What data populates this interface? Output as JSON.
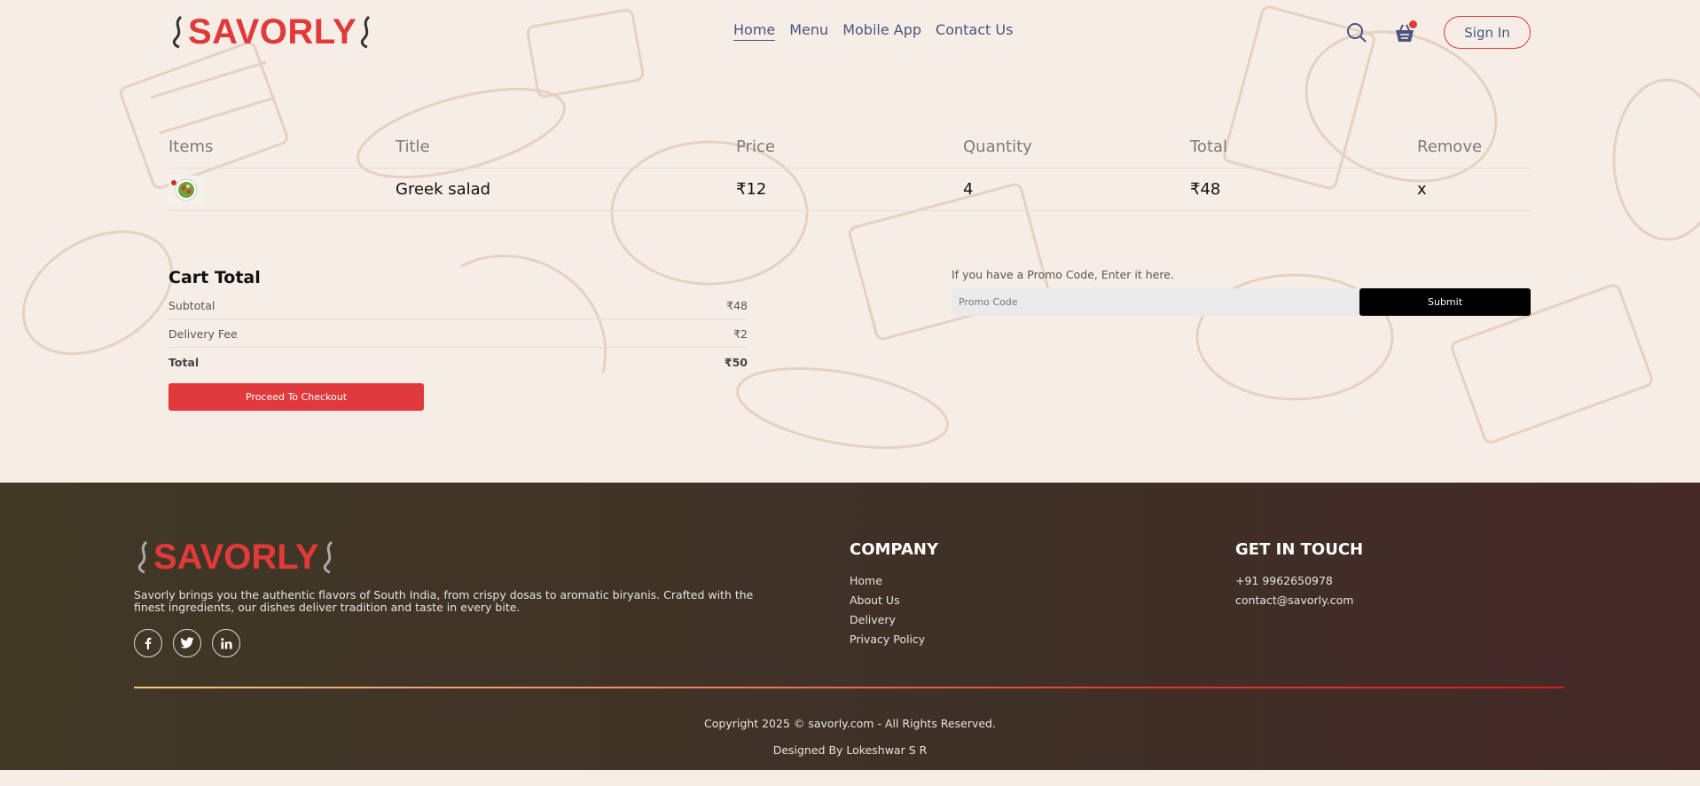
{
  "navbar": {
    "logo_text": "SAVORLY",
    "links": [
      "Home",
      "Menu",
      "Mobile App",
      "Contact Us"
    ],
    "active_link": "Home",
    "sign_in_label": "Sign In",
    "icons": [
      "search-icon",
      "basket-icon"
    ]
  },
  "cart": {
    "headers": [
      "Items",
      "Title",
      "Price",
      "Quantity",
      "Total",
      "Remove"
    ],
    "items": [
      {
        "image": "greek-salad-thumbnail",
        "title": "Greek salad",
        "price": "₹12",
        "quantity": "4",
        "total": "₹48",
        "remove": "x"
      }
    ]
  },
  "cart_total": {
    "heading": "Cart Total",
    "subtotal_label": "Subtotal",
    "subtotal_value": "₹48",
    "delivery_label": "Delivery Fee",
    "delivery_value": "₹2",
    "total_label": "Total",
    "total_value": "₹50",
    "checkout_label": "Proceed To Checkout"
  },
  "promo": {
    "prompt": "If you have a Promo Code, Enter it here.",
    "placeholder": "Promo Code",
    "submit_label": "Submit"
  },
  "footer": {
    "logo_text": "SAVORLY",
    "description": "Savorly brings you the authentic flavors of South India, from crispy dosas to aromatic biryanis. Crafted with the finest ingredients, our dishes deliver tradition and taste in every bite.",
    "socials": [
      "facebook-icon",
      "twitter-icon",
      "linkedin-icon"
    ],
    "company_heading": "COMPANY",
    "company_links": [
      "Home",
      "About Us",
      "Delivery",
      "Privacy Policy"
    ],
    "contact_heading": "GET IN TOUCH",
    "phone": "+91 9962650978",
    "email": "contact@savorly.com",
    "copyright": "Copyright 2025 © savorly.com - All Rights Reserved.",
    "designed_by": "Designed By Lokeshwar S R"
  },
  "colors": {
    "brand_red": "#e03a3a",
    "nav_text": "#49557e",
    "footer_bg": "#413826",
    "background": "#f7ede7"
  }
}
